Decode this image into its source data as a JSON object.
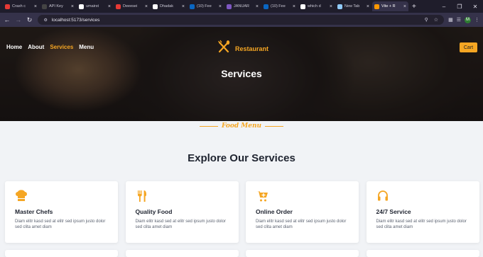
{
  "browser": {
    "tabs": [
      {
        "label": "Crash c",
        "color": "#e53935"
      },
      {
        "label": "API Key",
        "color": "#444444"
      },
      {
        "label": "umairst",
        "color": "#ffffff"
      },
      {
        "label": "Deeesei",
        "color": "#e53935"
      },
      {
        "label": "Dhadak",
        "color": "#ffffff"
      },
      {
        "label": "(10) Fee",
        "color": "#0a66c2"
      },
      {
        "label": "JANUAR",
        "color": "#7e57c2"
      },
      {
        "label": "(10) Fee",
        "color": "#0a66c2"
      },
      {
        "label": "which d",
        "color": "#ffffff"
      },
      {
        "label": "New Tab",
        "color": "#90caf9"
      },
      {
        "label": "Vite + R",
        "color": "#ff9800"
      }
    ],
    "url": "localhost:5173/services",
    "profile_initial": "M"
  },
  "nav": {
    "home": "Home",
    "about": "About",
    "services": "Services",
    "menu": "Menu"
  },
  "brand": {
    "name": "Restaurant"
  },
  "cart_label": "Cart",
  "hero_title": "Services",
  "subheading": "Food Menu",
  "section_title": "Explore Our Services",
  "accent_color": "#f5a623",
  "services": [
    {
      "icon": "chef-hat-icon",
      "title": "Master Chefs",
      "desc": "Diam elitr kasd sed at elitr sed ipsum justo dolor sed clita amet diam"
    },
    {
      "icon": "fork-knife-icon",
      "title": "Quality Food",
      "desc": "Diam elitr kasd sed at elitr sed ipsum justo dolor sed clita amet diam"
    },
    {
      "icon": "cart-plus-icon",
      "title": "Online Order",
      "desc": "Diam elitr kasd sed at elitr sed ipsum justo dolor sed clita amet diam"
    },
    {
      "icon": "headset-icon",
      "title": "24/7 Service",
      "desc": "Diam elitr kasd sed at elitr sed ipsum justo dolor sed clita amet diam"
    }
  ]
}
